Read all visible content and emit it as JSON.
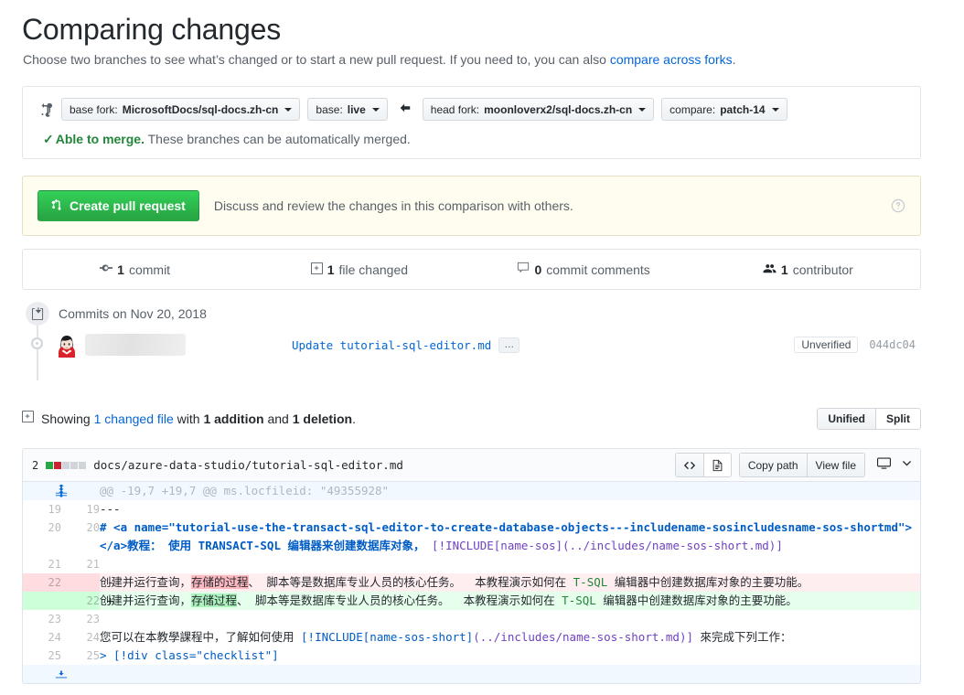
{
  "header": {
    "title": "Comparing changes",
    "subtitle_prefix": "Choose two branches to see what’s changed or to start a new pull request. If you need to, you can also ",
    "subtitle_link": "compare across forks",
    "subtitle_suffix": "."
  },
  "compare": {
    "swap_icon": "git-compare-icon",
    "base_fork_label": "base fork:",
    "base_fork_value": "MicrosoftDocs/sql-docs.zh-cn",
    "base_label": "base:",
    "base_value": "live",
    "arrow_icon": "arrow-left-icon",
    "head_fork_label": "head fork:",
    "head_fork_value": "moonloverx2/sql-docs.zh-cn",
    "compare_label": "compare:",
    "compare_value": "patch-14",
    "merge_check_icon": "check-icon",
    "merge_status_bold": "Able to merge.",
    "merge_status_rest": " These branches can be automatically merged."
  },
  "pr_banner": {
    "button_icon": "git-pull-request-icon",
    "button_label": "Create pull request",
    "description": "Discuss and review the changes in this comparison with others.",
    "help_icon": "question-icon",
    "background_color": "#fffdef",
    "button_color": "#28a745"
  },
  "stats": [
    {
      "icon": "commit-icon",
      "count": "1",
      "label": "commit"
    },
    {
      "icon": "file-diff-icon",
      "count": "1",
      "label": "file changed"
    },
    {
      "icon": "comment-icon",
      "count": "0",
      "label": "commit comments"
    },
    {
      "icon": "people-icon",
      "count": "1",
      "label": "contributor"
    }
  ],
  "commits": {
    "group_icon": "repo-push-icon",
    "group_label": "Commits on Nov 20, 2018",
    "author_avatar": "user-avatar",
    "author_name_redacted": true,
    "message": "Update tutorial-sql-editor.md",
    "ellipsis_label": "…",
    "verification_badge": "Unverified",
    "sha": "044dc04"
  },
  "showing": {
    "icon": "file-diff-icon",
    "prefix": "Showing ",
    "link": "1 changed file",
    "mid": " with ",
    "additions": "1 addition",
    "and": " and ",
    "deletions": "1 deletion",
    "suffix": ".",
    "view_unified": "Unified",
    "view_split": "Split",
    "active_view": "Unified"
  },
  "file": {
    "change_count": "2",
    "diffstat": [
      "add",
      "del",
      "none",
      "none",
      "none"
    ],
    "path": "docs/azure-data-studio/tutorial-sql-editor.md",
    "code_icon": "code-icon",
    "blob_icon": "file-icon",
    "copy_path_label": "Copy path",
    "view_file_label": "View file",
    "display_icon": "desktop-icon",
    "chevron_icon": "chevron-down-icon"
  },
  "diff": {
    "hunk_expand_icon": "unfold-icon",
    "hunk_header": "@@ -19,7 +19,7 @@ ms.locfileid: \"49355928\"",
    "rows": [
      {
        "type": "context",
        "old_line": "19",
        "new_line": "19",
        "marker": "",
        "text": "---"
      },
      {
        "type": "context",
        "old_line": "20",
        "new_line": "20",
        "marker": "",
        "text_line1_a": "# <a name=\"tutorial-use-the-transact-sql-editor-to-create-database-objects---includename-sosincludesname-sos-shortmd\"></a>",
        "text_line1_b": "教程： 使",
        "text_line2_a": "用 ",
        "text_line2_b": "TRANSACT-SQL ",
        "text_line2_c": "编辑器来创建数据库对象， ",
        "text_line2_d": "[!INCLUDE[name-sos](../includes/name-sos-short.md)]"
      },
      {
        "type": "context",
        "old_line": "21",
        "new_line": "21",
        "marker": "",
        "text": ""
      },
      {
        "type": "del",
        "old_line": "22",
        "new_line": "",
        "marker": "-",
        "text_pre": "创建并运行查询，",
        "text_hl": "存储的过程",
        "text_post": "、 脚本等是数据库专业人员的核心任务。  本教程演示如何在 ",
        "text_code": "T-SQL",
        "text_tail": " 编辑器中创建数据库对象的主要功能。"
      },
      {
        "type": "add",
        "old_line": "",
        "new_line": "22",
        "marker": "+",
        "text_pre": "创建并运行查询，",
        "text_hl": "存储过程",
        "text_post": "、 脚本等是数据库专业人员的核心任务。  本教程演示如何在 ",
        "text_code": "T-SQL",
        "text_tail": " 编辑器中创建数据库对象的主要功能。"
      },
      {
        "type": "context",
        "old_line": "23",
        "new_line": "23",
        "marker": "",
        "text": ""
      },
      {
        "type": "context",
        "old_line": "24",
        "new_line": "24",
        "marker": "",
        "text_pre": "您可以在本教學課程中，了解如何使用 ",
        "text_link": "[!INCLUDE[name-sos-short]",
        "text_mid": "(../includes/name-sos-short.md)]",
        "text_tail": " 來完成下列工作："
      },
      {
        "type": "context",
        "old_line": "25",
        "new_line": "25",
        "marker": "",
        "text_blue": "> [!div class=\"checklist\"]"
      }
    ],
    "bottom_expand_icon": "fold-down-icon"
  }
}
